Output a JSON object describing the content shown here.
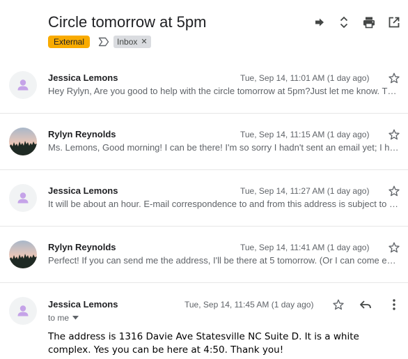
{
  "thread": {
    "subject": "Circle tomorrow at 5pm",
    "labels": {
      "external": "External",
      "inbox": "Inbox",
      "external_color": "#f9ab00"
    },
    "header_icons": [
      "move-to-icon",
      "expand-collapse-icon",
      "print-icon",
      "open-in-new-window-icon"
    ]
  },
  "messages": [
    {
      "sender": "Jessica Lemons",
      "date": "Tue, Sep 14, 11:01 AM (1 day ago)",
      "snippet": "Hey Rylyn, Are you good to help with the circle tomorrow at 5pm?Just let me know. Thanks!",
      "avatar": "default-person-icon"
    },
    {
      "sender": "Rylyn Reynolds",
      "date": "Tue, Sep 14, 11:15 AM (1 day ago)",
      "snippet": "Ms. Lemons, Good morning! I can be there! I'm so sorry I hadn't sent an email yet; I have been busy",
      "avatar": "profile-photo-sunset-trees"
    },
    {
      "sender": "Jessica Lemons",
      "date": "Tue, Sep 14, 11:27 AM (1 day ago)",
      "snippet": "It will be about an hour. E-mail correspondence to and from this address is subject to the North Carolina",
      "avatar": "default-person-icon"
    },
    {
      "sender": "Rylyn Reynolds",
      "date": "Tue, Sep 14, 11:41 AM (1 day ago)",
      "snippet": "Perfect! If you can send me the address, I'll be there at 5 tomorrow. (Or I can come early if needed)",
      "avatar": "profile-photo-sunset-trees"
    }
  ],
  "expanded": {
    "sender": "Jessica Lemons",
    "date": "Tue, Sep 14, 11:45 AM (1 day ago)",
    "to_me": "to me",
    "body": "The address is 1316 Davie Ave Statesville NC Suite D. It is a white complex. Yes you can be here at 4:50. Thank you!"
  }
}
